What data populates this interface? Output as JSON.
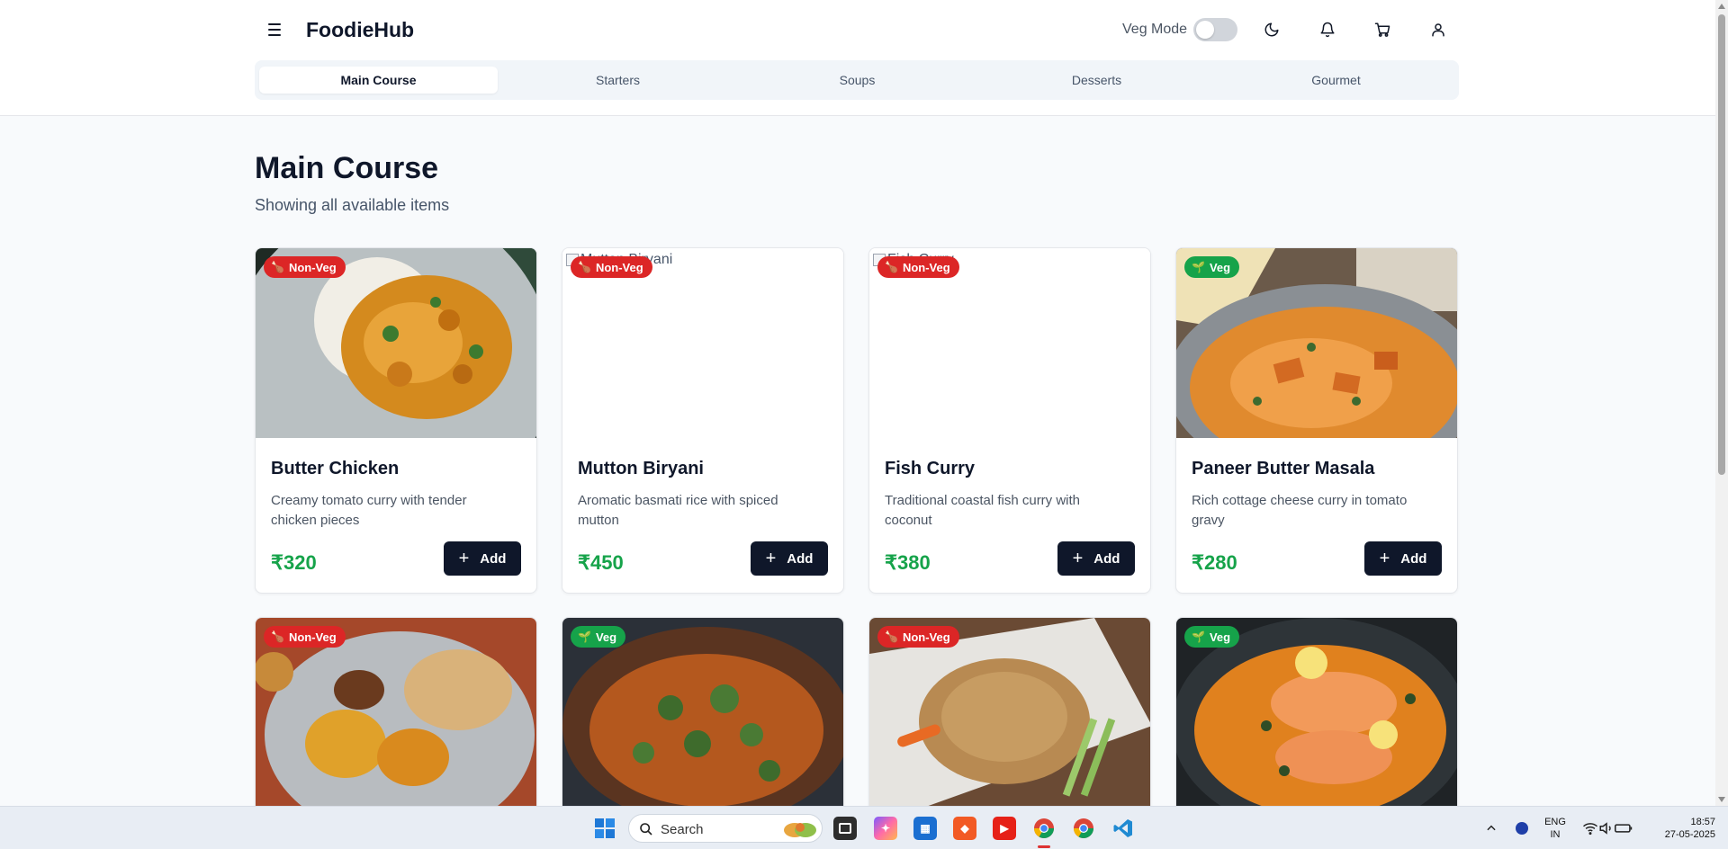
{
  "header": {
    "brand": "FoodieHub",
    "veg_mode_label": "Veg Mode",
    "veg_mode_on": false
  },
  "tabs": [
    {
      "label": "Main Course",
      "active": true
    },
    {
      "label": "Starters",
      "active": false
    },
    {
      "label": "Soups",
      "active": false
    },
    {
      "label": "Desserts",
      "active": false
    },
    {
      "label": "Gourmet",
      "active": false
    }
  ],
  "main": {
    "title": "Main Course",
    "subtitle": "Showing all available items",
    "add_label": "Add",
    "items": [
      {
        "name": "Butter Chicken",
        "desc": "Creamy tomato curry with tender chicken pieces",
        "price": "₹320",
        "badge": "Non-Veg",
        "image": "butter-chicken-photo"
      },
      {
        "name": "Mutton Biryani",
        "desc": "Aromatic basmati rice with spiced mutton",
        "price": "₹450",
        "badge": "Non-Veg",
        "image_alt": "Mutton Biryani"
      },
      {
        "name": "Fish Curry",
        "desc": "Traditional coastal fish curry with coconut",
        "price": "₹380",
        "badge": "Non-Veg",
        "image_alt": "Fish Curry"
      },
      {
        "name": "Paneer Butter Masala",
        "desc": "Rich cottage cheese curry in tomato gravy",
        "price": "₹280",
        "badge": "Veg",
        "image": "paneer-curry-photo"
      },
      {
        "badge": "Non-Veg",
        "image": "thali-photo"
      },
      {
        "badge": "Veg",
        "image": "vegetable-curry-photo"
      },
      {
        "badge": "Non-Veg",
        "image": "fried-rice-photo"
      },
      {
        "badge": "Veg",
        "image": "salmon-curry-photo"
      }
    ]
  },
  "taskbar": {
    "search_placeholder": "Search",
    "lang_line1": "ENG",
    "lang_line2": "IN",
    "time": "18:57",
    "date": "27-05-2025"
  },
  "colors": {
    "non_veg": "#dc2626",
    "veg": "#16a34a",
    "price": "#16a34a",
    "button": "#0f172a"
  }
}
